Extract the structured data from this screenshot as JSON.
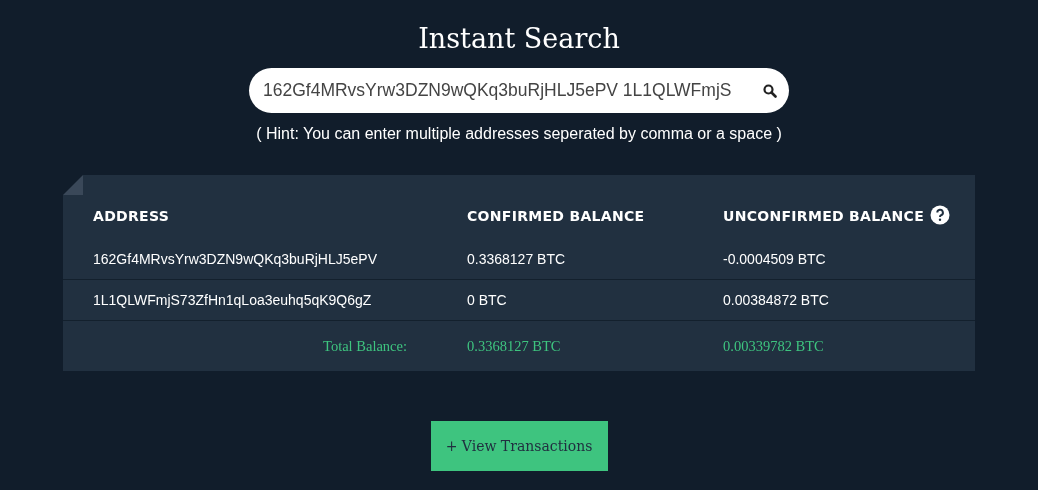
{
  "title": "Instant Search",
  "search": {
    "value": "162Gf4MRvsYrw3DZN9wQKq3buRjHLJ5ePV 1L1QLWFmjS"
  },
  "hint": "( Hint: You can enter multiple addresses seperated by comma or a space )",
  "table": {
    "columns": [
      "ADDRESS",
      "CONFIRMED BALANCE",
      "UNCONFIRMED BALANCE"
    ],
    "rows": [
      {
        "address": "162Gf4MRvsYrw3DZN9wQKq3buRjHLJ5ePV",
        "confirmed": "0.3368127 BTC",
        "unconfirmed": "-0.0004509 BTC"
      },
      {
        "address": "1L1QLWFmjS73ZfHn1qLoa3euhq5qK9Q6gZ",
        "confirmed": "0 BTC",
        "unconfirmed": "0.00384872 BTC"
      }
    ],
    "total": {
      "label": "Total Balance:",
      "confirmed": "0.3368127 BTC",
      "unconfirmed": "0.00339782 BTC"
    }
  },
  "button": "+ View Transactions"
}
